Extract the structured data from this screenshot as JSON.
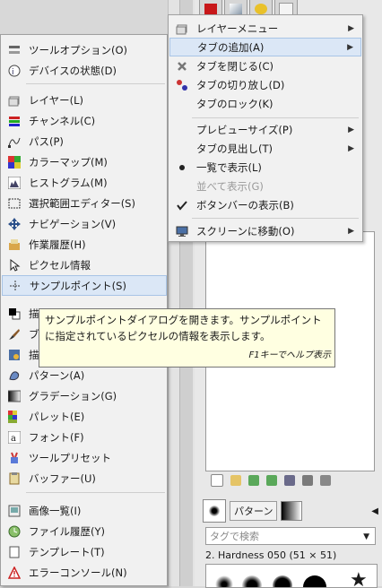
{
  "left_menu": {
    "items": [
      {
        "label": "ツールオプション(O)",
        "icon": "tool-options-icon"
      },
      {
        "label": "デバイスの状態(D)",
        "icon": "device-status-icon"
      },
      {
        "label": "レイヤー(L)",
        "icon": "layers-icon"
      },
      {
        "label": "チャンネル(C)",
        "icon": "channels-icon"
      },
      {
        "label": "パス(P)",
        "icon": "paths-icon"
      },
      {
        "label": "カラーマップ(M)",
        "icon": "colormap-icon"
      },
      {
        "label": "ヒストグラム(M)",
        "icon": "histogram-icon"
      },
      {
        "label": "選択範囲エディター(S)",
        "icon": "selection-editor-icon"
      },
      {
        "label": "ナビゲーション(V)",
        "icon": "navigation-icon"
      },
      {
        "label": "作業履歴(H)",
        "icon": "undo-history-icon"
      },
      {
        "label": "ピクセル情報",
        "icon": "pointer-icon"
      },
      {
        "label": "サンプルポイント(S)",
        "icon": "sample-points-icon"
      },
      {
        "label": "描",
        "icon": "fg-bg-colors-icon"
      },
      {
        "label": "ブ",
        "icon": "brushes-icon"
      },
      {
        "label": "描",
        "icon": "paint-dynamics-icon"
      },
      {
        "label": "パターン(A)",
        "icon": "patterns-icon"
      },
      {
        "label": "グラデーション(G)",
        "icon": "gradients-icon"
      },
      {
        "label": "パレット(E)",
        "icon": "palettes-icon"
      },
      {
        "label": "フォント(F)",
        "icon": "fonts-icon"
      },
      {
        "label": "ツールプリセット",
        "icon": "tool-presets-icon"
      },
      {
        "label": "バッファー(U)",
        "icon": "buffers-icon"
      },
      {
        "label": "画像一覧(I)",
        "icon": "images-icon"
      },
      {
        "label": "ファイル履歴(Y)",
        "icon": "document-history-icon"
      },
      {
        "label": "テンプレート(T)",
        "icon": "templates-icon"
      },
      {
        "label": "エラーコンソール(N)",
        "icon": "error-console-icon"
      }
    ]
  },
  "right_menu": {
    "items": [
      {
        "label": "レイヤーメニュー",
        "submenu": true
      },
      {
        "label": "タブの追加(A)",
        "submenu": true
      },
      {
        "label": "タブを閉じる(C)"
      },
      {
        "label": "タブの切り放し(D)"
      },
      {
        "label": "タブのロック(K)"
      },
      {
        "label": "プレビューサイズ(P)",
        "submenu": true
      },
      {
        "label": "タブの見出し(T)",
        "submenu": true
      },
      {
        "label": "一覧で表示(L)"
      },
      {
        "label": "並べて表示(G)"
      },
      {
        "label": "ボタンバーの表示(B)"
      },
      {
        "label": "スクリーンに移動(O)",
        "submenu": true
      }
    ]
  },
  "tooltip": {
    "line1": "サンプルポイントダイアログを開きます。サンプルポイント",
    "line2": "に指定されているピクセルの情報を表示します。",
    "help_hint": "F1キーでヘルプ表示"
  },
  "dock": {
    "patterns_tab": "パターン",
    "tag_placeholder": "タグで検索",
    "brush_name": "2. Hardness 050 (51 × 51)"
  },
  "colors": {
    "menu_bg": "#f1f1f1",
    "highlight": "#dbe7f6",
    "tooltip_bg": "#ffffe1"
  }
}
